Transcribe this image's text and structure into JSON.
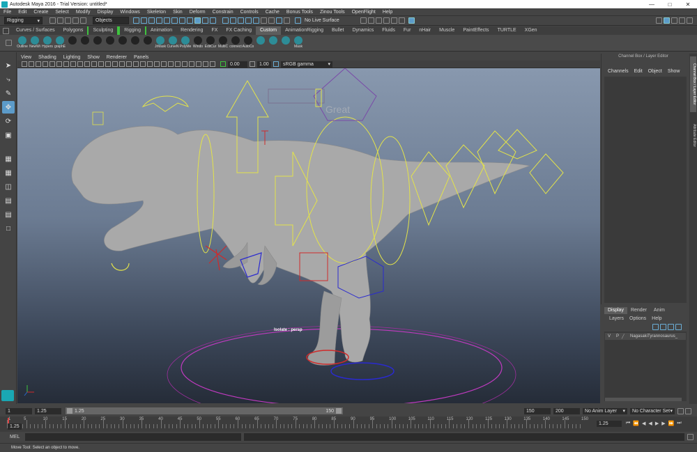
{
  "window": {
    "title": "Autodesk Maya 2016 - Trial Version: untitled*",
    "logo_icon": "maya-logo-icon"
  },
  "menu": [
    "File",
    "Edit",
    "Create",
    "Select",
    "Modify",
    "Display",
    "Windows",
    "Skeleton",
    "Skin",
    "Deform",
    "Constrain",
    "Controls",
    "Cache",
    "Bonus Tools",
    "Zinou Tools",
    "OpenFlight",
    "Help"
  ],
  "status": {
    "mode": "Rigging",
    "selection_mask": "Objects",
    "live_surface": "No Live Surface"
  },
  "shelf_tabs": [
    "Curves / Surfaces",
    "Polygons",
    "Sculpting",
    "Rigging",
    "Animation",
    "Rendering",
    "FX",
    "FX Caching",
    "Custom",
    "AnimationRigging",
    "Bullet",
    "Dynamics",
    "Fluids",
    "Fur",
    "nHair",
    "Muscle",
    "PaintEffects",
    "TURTLE",
    "XGen"
  ],
  "shelf_active_tab": "Custom",
  "shelf_labels": [
    "Outline",
    "NewWi",
    "Hypers",
    "graphE",
    "",
    "",
    "",
    "",
    "",
    "",
    "",
    "JrMask",
    "CurveN",
    "PolyMe",
    "Windo",
    "EditCur",
    "MultiC",
    "connect",
    "AutoCo",
    "",
    "",
    "",
    "Mask"
  ],
  "panel_menu": [
    "View",
    "Shading",
    "Lighting",
    "Show",
    "Renderer",
    "Panels"
  ],
  "panel_tools": {
    "exposure": "0.00",
    "gamma": "1.00",
    "color_space": "sRGB gamma"
  },
  "viewport": {
    "label": "Isolate : persp",
    "stage_text": "Great"
  },
  "channel_box": {
    "title": "Channel Box / Layer Editor",
    "menu": [
      "Channels",
      "Edit",
      "Object",
      "Show"
    ]
  },
  "side_tabs": [
    "Channel Box / Layer Editor",
    "Attribute Editor"
  ],
  "layer_editor": {
    "tabs": [
      "Display",
      "Render",
      "Anim"
    ],
    "menu": [
      "Layers",
      "Options",
      "Help"
    ],
    "layer": {
      "visible": "V",
      "playback": "P",
      "name": "NagasakiTyrannosaurus_"
    }
  },
  "range": {
    "start": "1",
    "current_start": "1.25",
    "slider_start": "1.25",
    "slider_end": "150",
    "end": "150",
    "anim_end": "200",
    "anim_layer": "No Anim Layer",
    "character_set": "No Character Set"
  },
  "timeline": {
    "ticks": [
      "1",
      "5",
      "10",
      "15",
      "20",
      "25",
      "30",
      "35",
      "40",
      "45",
      "50",
      "55",
      "60",
      "65",
      "70",
      "75",
      "80",
      "85",
      "90",
      "95",
      "100",
      "105",
      "110",
      "115",
      "120",
      "125",
      "130",
      "135",
      "140",
      "145",
      "150"
    ],
    "current_frame": "1.25"
  },
  "command_line": {
    "label": "MEL"
  },
  "help_line": {
    "text": "Move Tool: Select an object to move."
  }
}
